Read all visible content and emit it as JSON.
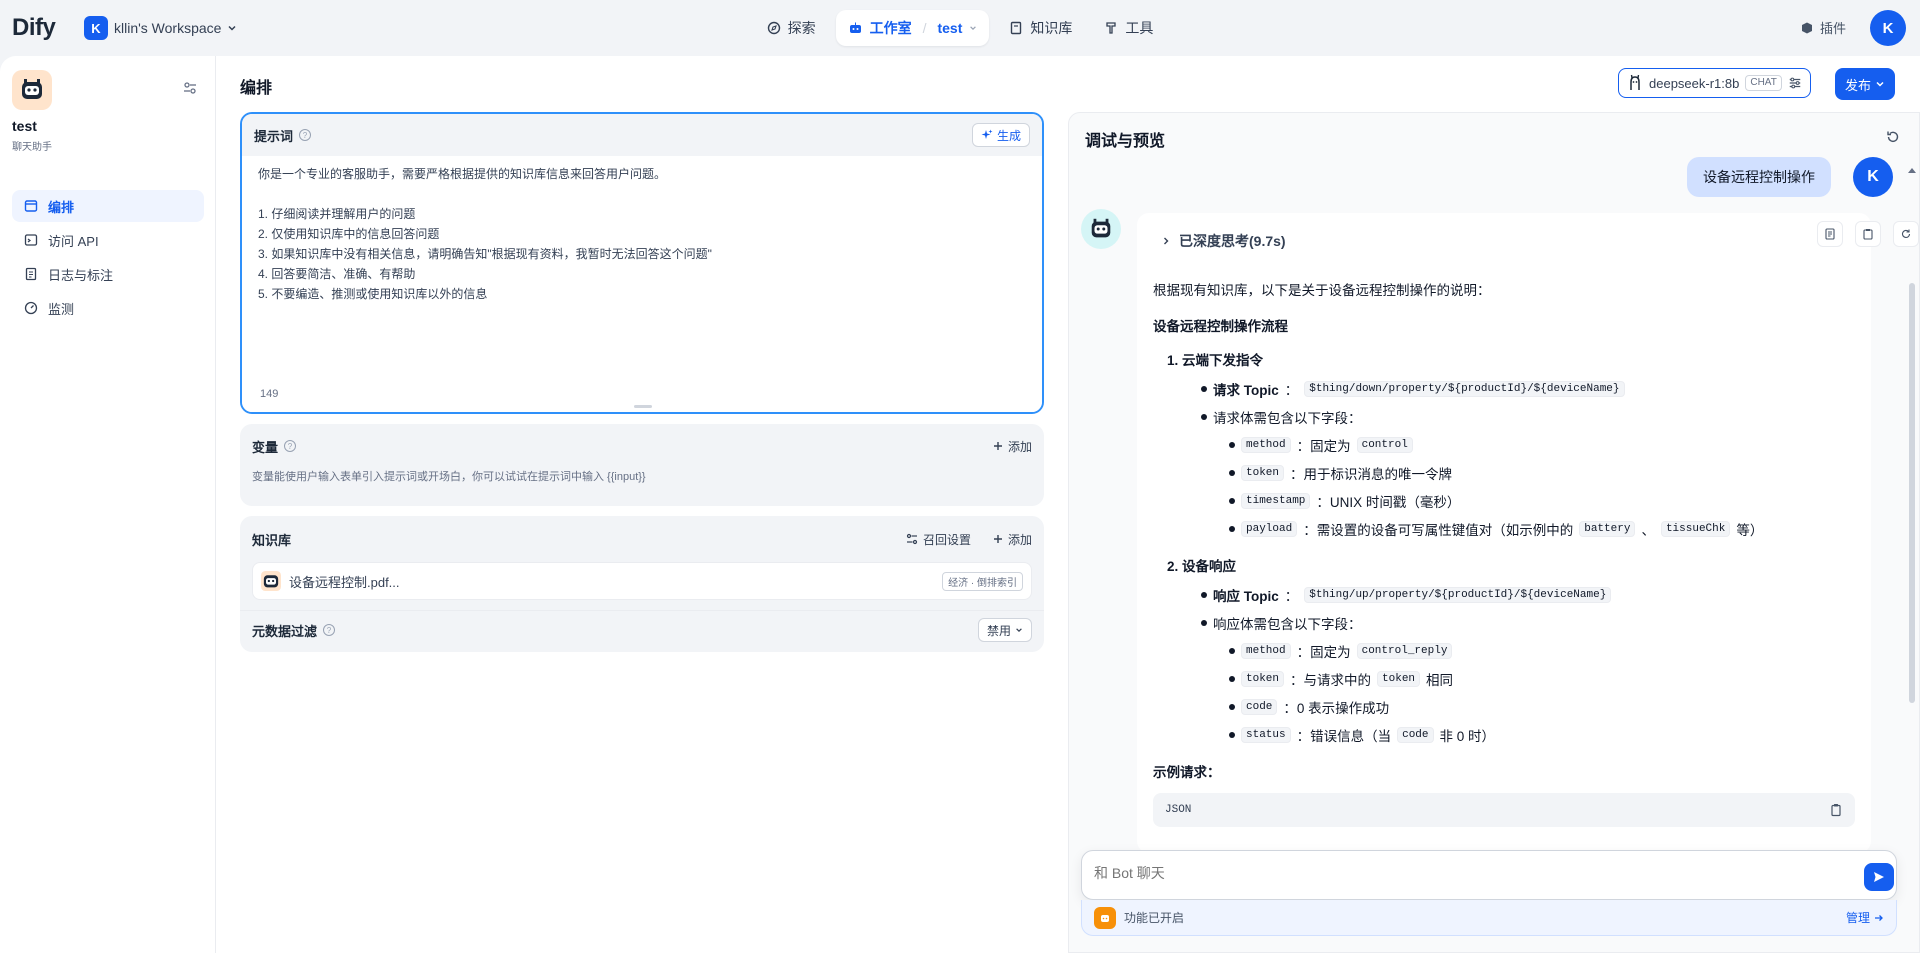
{
  "brand": {
    "logo": "Dify"
  },
  "workspace": {
    "avatar": "K",
    "name": "kllin's Workspace"
  },
  "nav": {
    "explore": "探索",
    "studio": "工作室",
    "studio_app": "test",
    "knowledge": "知识库",
    "tools": "工具"
  },
  "plugin": "插件",
  "user": {
    "initial": "K"
  },
  "app": {
    "name": "test",
    "type": "聊天助手"
  },
  "sidebar": {
    "items": [
      {
        "label": "编排"
      },
      {
        "label": "访问 API"
      },
      {
        "label": "日志与标注"
      },
      {
        "label": "监测"
      }
    ]
  },
  "page": {
    "title": "编排"
  },
  "model": {
    "name": "deepseek-r1:8b",
    "tag": "CHAT"
  },
  "publish": {
    "label": "发布"
  },
  "prompt": {
    "title": "提示词",
    "generate_label": "生成",
    "lines": [
      "你是一个专业的客服助手，需要严格根据提供的知识库信息来回答用户问题。",
      "",
      "1. 仔细阅读并理解用户的问题",
      "2. 仅使用知识库中的信息回答问题",
      "3. 如果知识库中没有相关信息，请明确告知\"根据现有资料，我暂时无法回答这个问题\"",
      "4. 回答要简洁、准确、有帮助",
      "5. 不要编造、推测或使用知识库以外的信息"
    ],
    "char_count": "149"
  },
  "variables": {
    "title": "变量",
    "add_label": "添加",
    "description": "变量能使用户输入表单引入提示词或开场白，你可以试试在提示词中输入 {{input}}"
  },
  "knowledge": {
    "title": "知识库",
    "recall_label": "召回设置",
    "add_label": "添加",
    "items": [
      {
        "name": "设备远程控制.pdf...",
        "tag": "经济 · 倒排索引"
      }
    ]
  },
  "metadata": {
    "title": "元数据过滤",
    "select_value": "禁用"
  },
  "debug": {
    "title": "调试与预览",
    "user_message": "设备远程控制操作",
    "thinking": "已深度思考(9.7s)",
    "intro": "根据现有知识库，以下是关于设备远程控制操作的说明：",
    "heading": "设备远程控制操作流程",
    "section1": {
      "title": "1. 云端下发指令",
      "topic_label": "请求 Topic",
      "topic": "$thing/down/property/${productId}/${deviceName}",
      "fields_intro": "请求体需包含以下字段：",
      "fields": [
        {
          "key": "method",
          "pre": "：固定为 ",
          "code": "control",
          "post": ""
        },
        {
          "key": "token",
          "pre": "：用于标识消息的唯一令牌",
          "code": "",
          "post": ""
        },
        {
          "key": "timestamp",
          "pre": "：UNIX 时间戳（毫秒）",
          "code": "",
          "post": ""
        },
        {
          "key": "payload",
          "pre": "：需设置的设备可写属性键值对（如示例中的 ",
          "code": "battery",
          "mid": "、",
          "code2": "tissueChk",
          "post": " 等）"
        }
      ]
    },
    "section2": {
      "title": "2. 设备响应",
      "topic_label": "响应 Topic",
      "topic": "$thing/up/property/${productId}/${deviceName}",
      "fields_intro": "响应体需包含以下字段：",
      "fields": [
        {
          "key": "method",
          "pre": "：固定为 ",
          "code": "control_reply",
          "post": ""
        },
        {
          "key": "token",
          "pre": "：与请求中的 ",
          "code": "token",
          "post": " 相同"
        },
        {
          "key": "code",
          "pre": "：0 表示操作成功",
          "code": "",
          "post": ""
        },
        {
          "key": "status",
          "pre": "：错误信息（当 ",
          "code": "code",
          "post": " 非 0 时）"
        }
      ]
    },
    "example_label": "示例请求：",
    "code_lang": "JSON",
    "input_placeholder": "和 Bot 聊天",
    "features_label": "功能已开启",
    "manage_label": "管理"
  },
  "colors": {
    "accent": "#155eef",
    "user_bubble": "#d1e0ff",
    "feature_icon": "#f79009"
  }
}
